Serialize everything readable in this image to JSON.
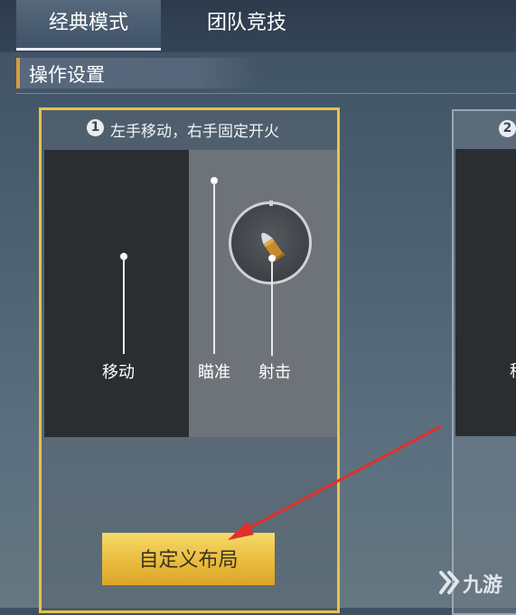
{
  "tabs": [
    {
      "label": "经典模式",
      "active": true
    },
    {
      "label": "团队竞技",
      "active": false
    }
  ],
  "section": {
    "title": "操作设置"
  },
  "cards": [
    {
      "number": "1",
      "title": "左手移动，右手固定开火",
      "zones": {
        "move_label": "移动",
        "aim_label": "瞄准",
        "shoot_label": "射击"
      },
      "button_label": "自定义布局",
      "selected": true
    },
    {
      "number": "2",
      "partial_label": "移"
    }
  ],
  "watermark": {
    "text": "九游"
  },
  "colors": {
    "accent_gold": "#e6c24a",
    "button_gold": "#e8b93a",
    "arrow_red": "#e0302a",
    "section_bar": "#d89a3a"
  },
  "icons": {
    "fire": "bullet-icon",
    "watermark": "jiuyou-logo-icon"
  }
}
